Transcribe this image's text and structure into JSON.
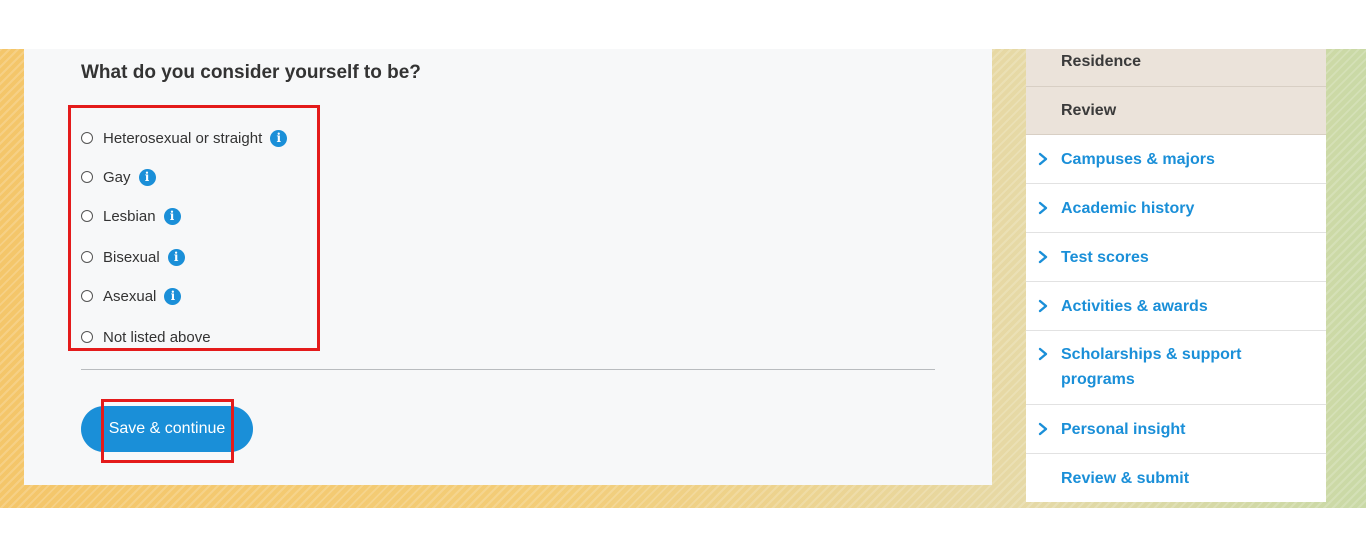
{
  "question": {
    "title": "What do you consider yourself to be?",
    "options": [
      {
        "label": "Heterosexual or straight",
        "info": true
      },
      {
        "label": "Gay",
        "info": true
      },
      {
        "label": "Lesbian",
        "info": true
      },
      {
        "label": "Bisexual",
        "info": true
      },
      {
        "label": "Asexual",
        "info": true
      },
      {
        "label": "Not listed above",
        "info": false
      }
    ],
    "info_glyph": "i"
  },
  "actions": {
    "save_label": "Save & continue"
  },
  "sidebar": {
    "items": [
      {
        "label": "Residence",
        "style": "sub",
        "chevron": false
      },
      {
        "label": "Review",
        "style": "sub",
        "chevron": false
      },
      {
        "label": "Campuses & majors",
        "style": "link",
        "chevron": true
      },
      {
        "label": "Academic history",
        "style": "link",
        "chevron": true
      },
      {
        "label": "Test scores",
        "style": "link",
        "chevron": true
      },
      {
        "label": "Activities & awards",
        "style": "link",
        "chevron": true
      },
      {
        "label": "Scholarships & support programs",
        "style": "link",
        "chevron": true,
        "lines": [
          "Scholarships & support",
          "programs"
        ]
      },
      {
        "label": "Personal insight",
        "style": "link",
        "chevron": true
      },
      {
        "label": "Review & submit",
        "style": "link",
        "chevron": false
      }
    ]
  },
  "colors": {
    "accent": "#1a8fd8",
    "highlight_box": "#e41b1b",
    "sidebar_sub_bg": "#ebe3da"
  }
}
